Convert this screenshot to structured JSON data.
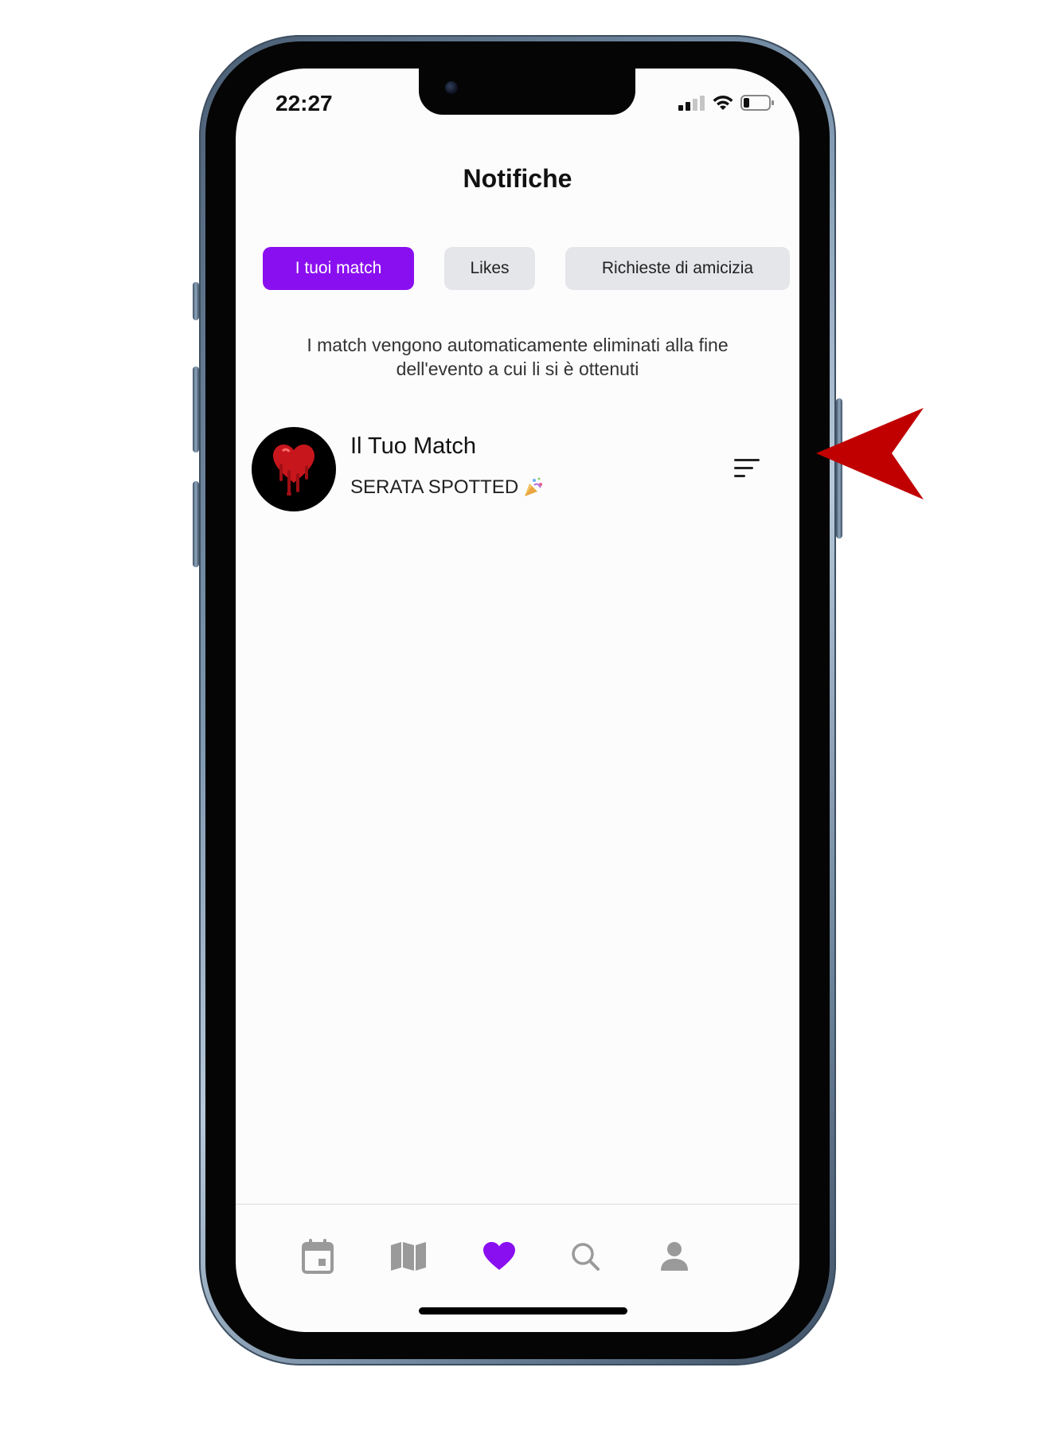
{
  "status_bar": {
    "time": "22:27"
  },
  "header": {
    "title": "Notifiche"
  },
  "tabs": [
    {
      "label": "I tuoi match",
      "active": true
    },
    {
      "label": "Likes",
      "active": false
    },
    {
      "label": "Richieste di amicizia",
      "active": false
    }
  ],
  "info_text": "I match vengono automaticamente eliminati alla fine dell'evento a cui li si è ottenuti",
  "match": {
    "title": "Il Tuo Match",
    "subtitle": "SERATA SPOTTED",
    "subtitle_emoji": "party-popper-icon"
  },
  "bottom_nav": [
    {
      "icon": "calendar-icon",
      "active": false
    },
    {
      "icon": "map-icon",
      "active": false
    },
    {
      "icon": "heart-icon",
      "active": true
    },
    {
      "icon": "search-icon",
      "active": false
    },
    {
      "icon": "profile-icon",
      "active": false
    }
  ],
  "colors": {
    "accent": "#8a0ff0",
    "tab_inactive": "#e5e6ea",
    "nav_inactive": "#9a9a9a",
    "arrow": "#c00000"
  }
}
